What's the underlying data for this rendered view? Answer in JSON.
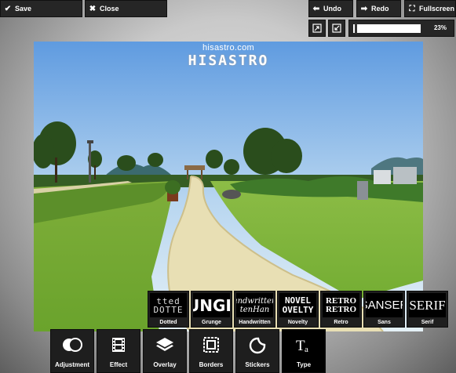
{
  "toolbar": {
    "save_label": "Save",
    "close_label": "Close",
    "undo_label": "Undo",
    "redo_label": "Redo",
    "fullscreen_label": "Fullscreen"
  },
  "zoom": {
    "percent_label": "23%",
    "value": 0.23
  },
  "watermark": {
    "url": "hisastro.com",
    "logo": "HISASTRO"
  },
  "font_styles": [
    {
      "label": "Dotted",
      "preview": "tted DOTTE",
      "icon": "dotted-font-preview"
    },
    {
      "label": "Grunge",
      "preview": "UNGE",
      "icon": "grunge-font-preview"
    },
    {
      "label": "Handwritten",
      "preview": "andwritten tenHan",
      "icon": "handwritten-font-preview"
    },
    {
      "label": "Novelty",
      "preview": "NOVEL OVELTY",
      "icon": "novelty-font-preview"
    },
    {
      "label": "Retro",
      "preview": "RETRO RETRO",
      "icon": "retro-font-preview"
    },
    {
      "label": "Sans",
      "preview": "SANSER",
      "icon": "sans-font-preview"
    },
    {
      "label": "Serif",
      "preview": "SERIF",
      "icon": "serif-font-preview"
    }
  ],
  "tools": [
    {
      "label": "Adjustment",
      "icon": "adjustment-icon"
    },
    {
      "label": "Effect",
      "icon": "film-icon"
    },
    {
      "label": "Overlay",
      "icon": "layers-icon"
    },
    {
      "label": "Borders",
      "icon": "frame-icon"
    },
    {
      "label": "Stickers",
      "icon": "sticker-icon"
    },
    {
      "label": "Type",
      "icon": "type-icon"
    }
  ],
  "active_tool": "Type"
}
